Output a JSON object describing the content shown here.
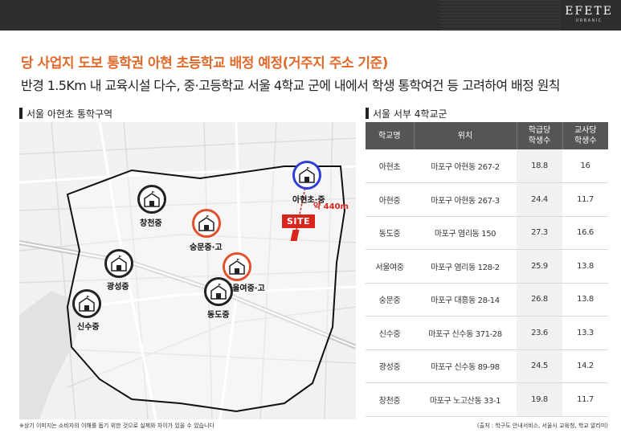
{
  "brand": {
    "name": "EFETE",
    "sub": "URBANIC"
  },
  "headline": "당 사업지 도보 통학권 아현 초등학교 배정 예정(거주지 주소 기준)",
  "subheadline": "반경 1.5Km 내 교육시설 다수, 중·고등학교 서울 4학교 군에 내에서 학생 통학여건 등 고려하여 배정 원칙",
  "map_section": {
    "title": "서울 아현초 통학구역",
    "site_label": "SITE",
    "distance_label": "약 440m",
    "schools": [
      {
        "name": "아현초·중",
        "ring": "blue"
      },
      {
        "name": "창천중",
        "ring": "black"
      },
      {
        "name": "숭문중·고",
        "ring": "red"
      },
      {
        "name": "광성중",
        "ring": "black"
      },
      {
        "name": "서울여중·고",
        "ring": "red"
      },
      {
        "name": "동도중",
        "ring": "black"
      },
      {
        "name": "신수중",
        "ring": "black"
      }
    ]
  },
  "table_section": {
    "title": "서울 서부 4학교군",
    "headers": [
      "학교명",
      "위치",
      "학급당\n학생수",
      "교사당\n학생수"
    ],
    "rows": [
      [
        "아현초",
        "마포구 아현동 267-2",
        "18.8",
        "16"
      ],
      [
        "아현중",
        "마포구 아현동 267-3",
        "24.4",
        "11.7"
      ],
      [
        "동도중",
        "마포구 염리동 150",
        "27.3",
        "16.6"
      ],
      [
        "서울여중",
        "마포구 염리동 128-2",
        "25.9",
        "13.8"
      ],
      [
        "숭문중",
        "마포구 대흥동 28-14",
        "26.8",
        "13.8"
      ],
      [
        "신수중",
        "마포구 신수동 371-28",
        "23.6",
        "13.3"
      ],
      [
        "광성중",
        "마포구 신수동 89-98",
        "24.5",
        "14.2"
      ],
      [
        "창천중",
        "마포구 노고산동 33-1",
        "19.8",
        "11.7"
      ]
    ]
  },
  "footnote": "※상기 이미지는 소비자의 이해를 돕기 위한 것으로 실제와 차이가 있을 수 있습니다",
  "source": "(출처 : 학구도 안내서비스, 서울시 교육청, 학교 알리미)",
  "colors": {
    "accent": "#e0692a",
    "site": "#d9251c",
    "header": "#555555",
    "ring_blue": "#2f3fd6",
    "ring_red": "#e0502e"
  }
}
